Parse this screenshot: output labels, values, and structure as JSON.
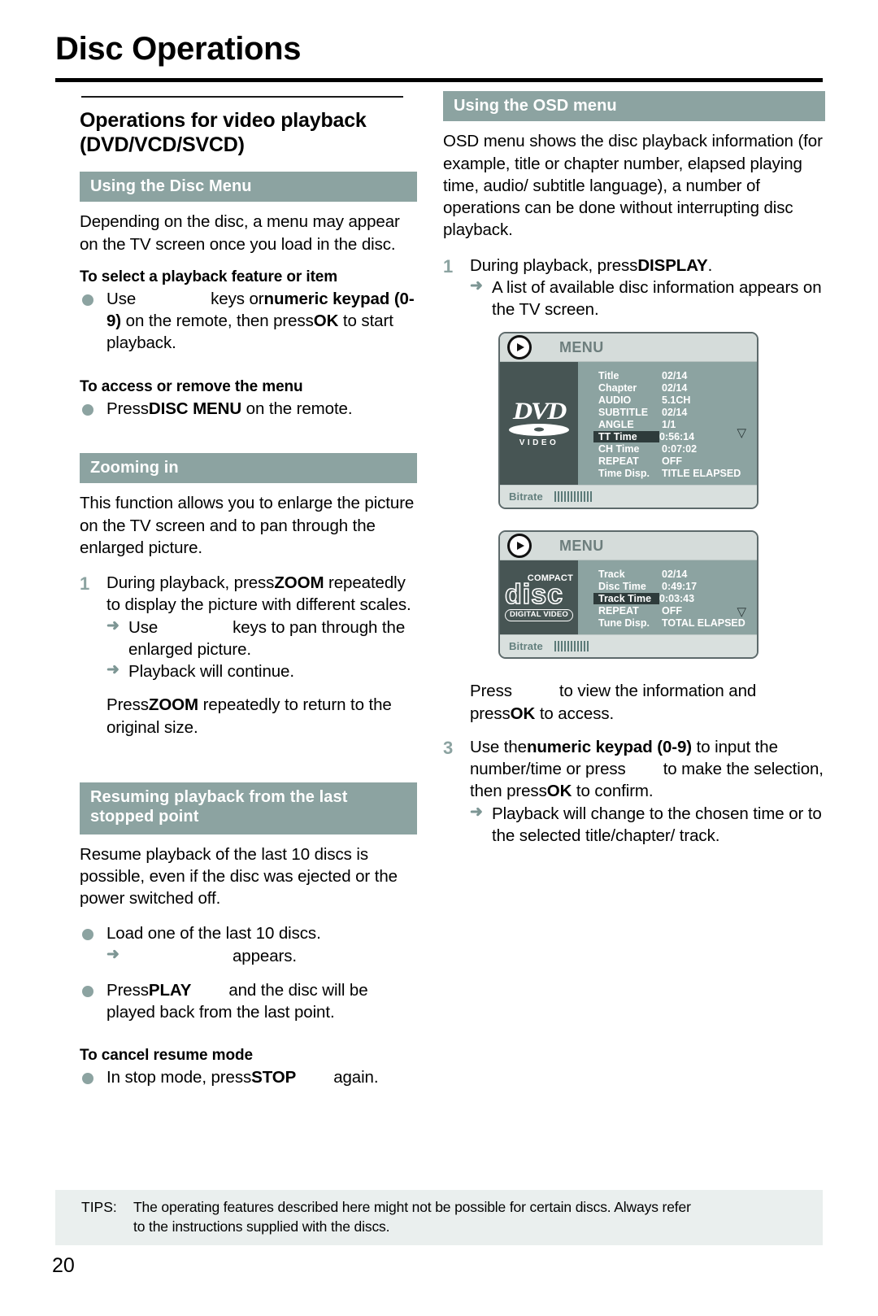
{
  "page": {
    "title": "Disc Operations",
    "number": "20"
  },
  "left": {
    "section_title_line1": "Operations for video playback",
    "section_title_line2": "(DVD/VCD/SVCD)",
    "disc_menu": {
      "banner": "Using the Disc Menu",
      "intro": "Depending on the disc, a menu may appear on the TV screen once you load in the disc.",
      "subhead1": "To select a playback feature or item",
      "bullet1_a": "Use",
      "bullet1_b": "keys or",
      "bullet1_c": "numeric keypad (0-9)",
      "bullet1_d": "on the remote, then press",
      "bullet1_e": "OK",
      "bullet1_f": "to start playback.",
      "subhead2": "To access or remove the menu",
      "bullet2_a": "Press",
      "bullet2_b": "DISC MENU",
      "bullet2_c": "on the remote."
    },
    "zooming": {
      "banner": "Zooming in",
      "intro": "This function allows you to enlarge the picture on the TV screen and to pan through the enlarged picture.",
      "step1_num": "1",
      "step1_a": "During playback, press",
      "step1_b": "ZOOM",
      "step1_c": "repeatedly to display the picture with different scales.",
      "step1_arrow1_a": "Use",
      "step1_arrow1_b": "keys to pan through the enlarged picture.",
      "step1_arrow2": "Playback will continue.",
      "closing_a": "Press",
      "closing_b": "ZOOM",
      "closing_c": "repeatedly to return to the original size."
    },
    "resuming": {
      "banner_line1": "Resuming playback from the last",
      "banner_line2": "stopped point",
      "intro": "Resume playback of the last 10 discs is possible, even if the disc was ejected or the power switched off.",
      "bullet1": "Load one of the last 10 discs.",
      "bullet1_arrow": "appears.",
      "bullet2_a": "Press",
      "bullet2_b": "PLAY",
      "bullet2_c": "and the disc will be played back from the last point.",
      "subhead": "To cancel resume mode",
      "bullet3_a": "In stop mode, press",
      "bullet3_b": "STOP",
      "bullet3_c": "again."
    }
  },
  "right": {
    "osd": {
      "banner": "Using the OSD menu",
      "intro": "OSD menu shows the disc playback information (for example, title or chapter number, elapsed playing time, audio/ subtitle language), a number of operations can be done without interrupting disc playback.",
      "step1_num": "1",
      "step1_a": "During playback, press",
      "step1_b": "DISPLAY",
      "step1_c": ".",
      "step1_arrow": "A list of available disc information appears on the TV screen.",
      "step2_num": "",
      "step2_a": "Press",
      "step2_b": "to view the information and press",
      "step2_c": "OK",
      "step2_d": "to access.",
      "step3_num": "3",
      "step3_a": "Use the",
      "step3_b": "numeric keypad (0-9)",
      "step3_c": "to input the number/time or press",
      "step3_d": "to make the selection, then press",
      "step3_e": "OK",
      "step3_f": "to confirm.",
      "step3_arrow": "Playback will change to the chosen time or to the selected title/chapter/ track."
    },
    "menu_dvd": {
      "header": "MENU",
      "logo": "dvd-video-logo",
      "rows": [
        {
          "label": "Title",
          "value": "02/14",
          "selected": false
        },
        {
          "label": "Chapter",
          "value": "02/14",
          "selected": false
        },
        {
          "label": "AUDIO",
          "value": "5.1CH",
          "selected": false
        },
        {
          "label": "SUBTITLE",
          "value": "02/14",
          "selected": false
        },
        {
          "label": "ANGLE",
          "value": "1/1",
          "selected": false
        },
        {
          "label": "TT Time",
          "value": "0:56:14",
          "selected": true
        },
        {
          "label": "CH Time",
          "value": "0:07:02",
          "selected": false
        },
        {
          "label": "REPEAT",
          "value": "OFF",
          "selected": false
        },
        {
          "label": "Time Disp.",
          "value": "TITLE ELAPSED",
          "selected": false
        }
      ],
      "scroll_indicator": "▽",
      "bitrate_label": "Bitrate",
      "bitrate_bars": 12
    },
    "menu_cd": {
      "header": "MENU",
      "logo": "compact-disc-digital-video-logo",
      "logo_compact": "COMPACT",
      "logo_disc": "disc",
      "logo_digital_video": "DIGITAL VIDEO",
      "rows": [
        {
          "label": "Track",
          "value": "02/14",
          "selected": false
        },
        {
          "label": "Disc Time",
          "value": "0:49:17",
          "selected": false
        },
        {
          "label": "Track Time",
          "value": "0:03:43",
          "selected": true
        },
        {
          "label": "REPEAT",
          "value": "OFF",
          "selected": false
        },
        {
          "label": "Tune Disp.",
          "value": "TOTAL ELAPSED",
          "selected": false
        }
      ],
      "scroll_indicator": "▽",
      "bitrate_label": "Bitrate",
      "bitrate_bars": 11
    }
  },
  "tips": {
    "label": "TIPS:",
    "line1": "The operating features described here might not be possible for certain discs.  Always refer",
    "line2": "to the instructions supplied with the discs."
  },
  "colors": {
    "banner": "#8ca3a1",
    "bullet": "#8ca3a1",
    "step_number": "#8ca3a1",
    "osd_panel": "#8ca3a1",
    "osd_logo_panel": "#475554",
    "osd_chrome": "#d9e0de",
    "tips_bg": "#eaefee"
  }
}
